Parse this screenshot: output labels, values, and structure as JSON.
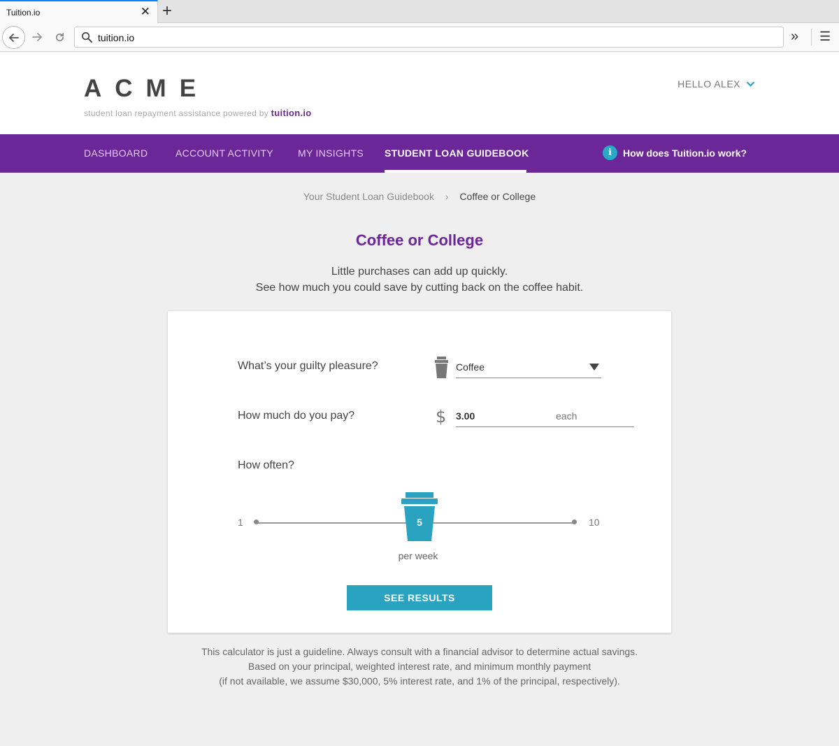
{
  "browser": {
    "tab_title": "Tuition.io",
    "tab_close": "✕",
    "new_tab": "+",
    "url": "tuition.io"
  },
  "header": {
    "logo": "ACME",
    "tagline_prefix": "student loan repayment assistance powered by",
    "tagline_brand": "tuition.io",
    "user_greeting": "HELLO ALEX"
  },
  "nav": {
    "items": [
      {
        "label": "DASHBOARD"
      },
      {
        "label": "ACCOUNT ACTIVITY"
      },
      {
        "label": "MY INSIGHTS"
      },
      {
        "label": "STUDENT LOAN GUIDEBOOK"
      }
    ],
    "active_index": 3,
    "help_label": "How does Tuition.io work?",
    "help_icon": "i"
  },
  "breadcrumb": {
    "parent": "Your Student Loan Guidebook",
    "separator": "›",
    "current": "Coffee or College"
  },
  "page": {
    "title": "Coffee or College",
    "subtitle_line1": "Little purchases can add up quickly.",
    "subtitle_line2": "See how much you could save by cutting back on the coffee habit."
  },
  "form": {
    "pleasure_label": "What’s your guilty pleasure?",
    "pleasure_value": "Coffee",
    "price_label": "How much do you pay?",
    "currency_symbol": "$",
    "price_value": "3.00",
    "price_suffix": "each",
    "frequency_label": "How often?",
    "slider_min": "1",
    "slider_max": "10",
    "slider_value": "5",
    "slider_unit": "per week",
    "submit_label": "SEE RESULTS"
  },
  "disclaimer": {
    "line1": "This calculator is just a guideline. Always consult with a financial advisor to determine actual savings.",
    "line2": "Based on your principal, weighted interest rate, and minimum monthly payment",
    "line3": "(if not available, we assume $30,000, 5% interest rate, and 1% of the principal, respectively)."
  },
  "colors": {
    "brand_purple": "#6b2697",
    "accent_teal": "#29a3bf",
    "background": "#efefef"
  }
}
